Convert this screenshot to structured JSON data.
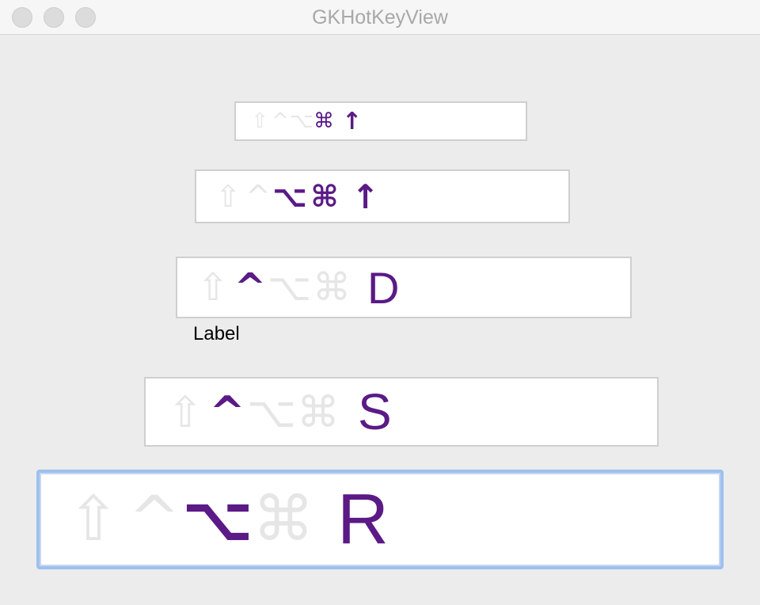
{
  "window": {
    "title": "GKHotKeyView"
  },
  "hotkeys": [
    {
      "glyphs": [
        "⇧",
        "^",
        "⌥",
        "⌘"
      ],
      "active": [
        false,
        false,
        false,
        true
      ],
      "key": "↑"
    },
    {
      "glyphs": [
        "⇧",
        "^",
        "⌥",
        "⌘"
      ],
      "active": [
        false,
        false,
        true,
        true
      ],
      "key": "↑"
    },
    {
      "glyphs": [
        "⇧",
        "^",
        "⌥",
        "⌘"
      ],
      "active": [
        false,
        true,
        false,
        false
      ],
      "key": "D"
    },
    {
      "glyphs": [
        "⇧",
        "^",
        "⌥",
        "⌘"
      ],
      "active": [
        false,
        true,
        false,
        false
      ],
      "key": "S"
    },
    {
      "glyphs": [
        "⇧",
        "^",
        "⌥",
        "⌘"
      ],
      "active": [
        false,
        false,
        true,
        false
      ],
      "key": "R"
    }
  ],
  "label": {
    "text": "Label"
  },
  "colors": {
    "active": "#5b1a86",
    "inactive": "#e6e6e6",
    "focus_ring": "#9ec0f0"
  }
}
